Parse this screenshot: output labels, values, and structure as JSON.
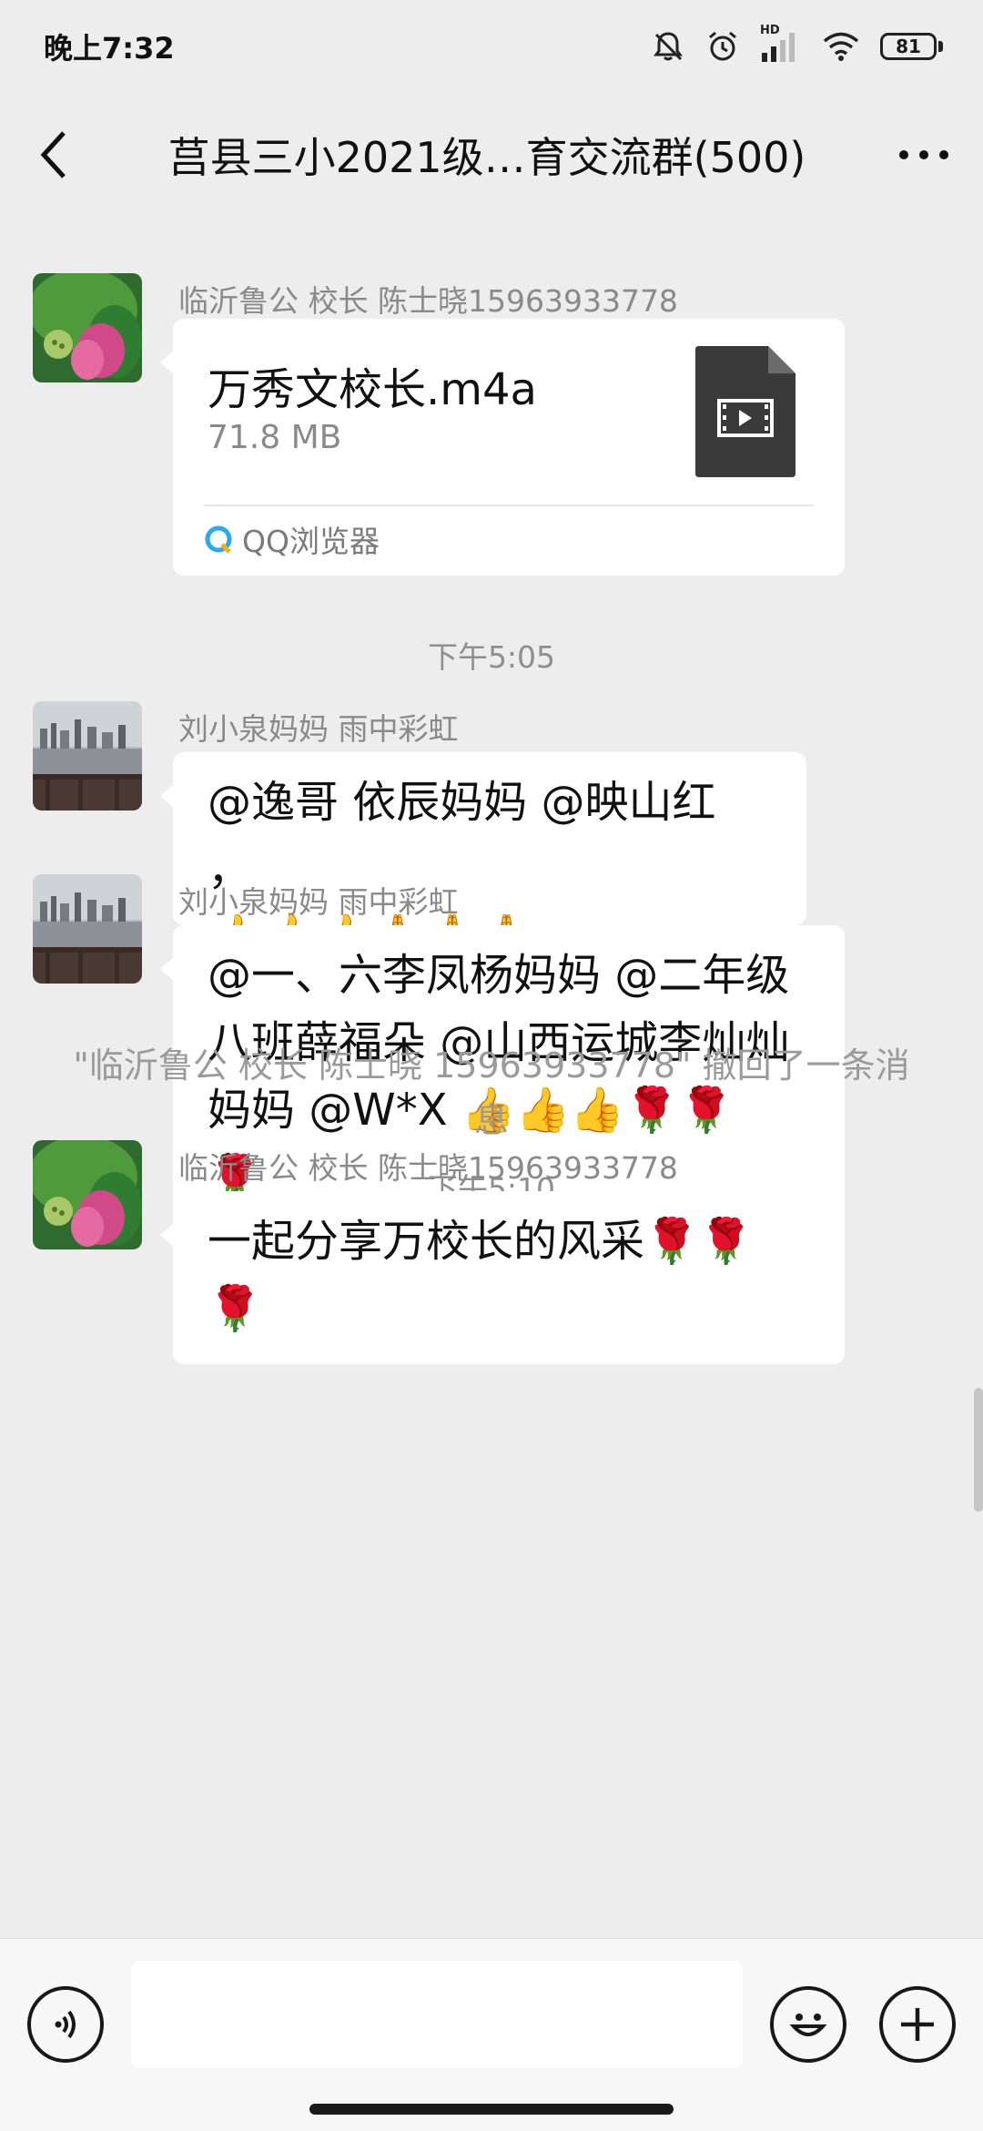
{
  "status_bar": {
    "time": "晚上7:32",
    "battery": "81",
    "hd_label": "HD"
  },
  "header": {
    "title": "莒县三小2021级…育交流群(500)"
  },
  "messages": [
    {
      "type": "file",
      "sender": "临沂鲁公 校长  陈士晓15963933778",
      "file_name": "万秀文校长.m4a",
      "file_size": "71.8 MB",
      "source": "QQ浏览器",
      "avatar": "lotus-avatar"
    },
    {
      "type": "time",
      "text": "下午5:05"
    },
    {
      "type": "text",
      "sender": "刘小泉妈妈  雨中彩虹",
      "text": "@逸哥 依辰妈妈 @映山红 ，",
      "emoji": "👍👍👍🙏🙏🙏",
      "avatar": "lake-avatar"
    },
    {
      "type": "text",
      "sender": "刘小泉妈妈  雨中彩虹",
      "lines": [
        "@一、六李凤杨妈妈 @二年级",
        "八班薛福朵 @山西运城李灿灿",
        "妈妈 @W*X "
      ],
      "emoji_inline": "👍👍👍🌹🌹",
      "emoji_last": "🌹",
      "avatar": "lake-avatar"
    },
    {
      "type": "time",
      "text": "下午5:10"
    },
    {
      "type": "recall",
      "text": "\"临沂鲁公 校长  陈士晓 15963933778\" 撤回了一条消息"
    },
    {
      "type": "text",
      "sender": "临沂鲁公 校长  陈士晓15963933778",
      "text": "一起分享万校长的风采",
      "emoji_inline": "🌹🌹",
      "emoji_last": "🌹",
      "avatar": "lotus-avatar"
    }
  ],
  "input_bar": {
    "placeholder": "",
    "value": ""
  },
  "icons": {
    "back": "chevron-left-icon",
    "more": "more-dots-icon",
    "voice": "voice-icon",
    "emoji": "smiley-icon",
    "plus": "plus-icon",
    "file": "video-file-icon"
  },
  "colors": {
    "background": "#ededed",
    "bubble": "#ffffff",
    "meta_text": "#8a8a8a"
  }
}
